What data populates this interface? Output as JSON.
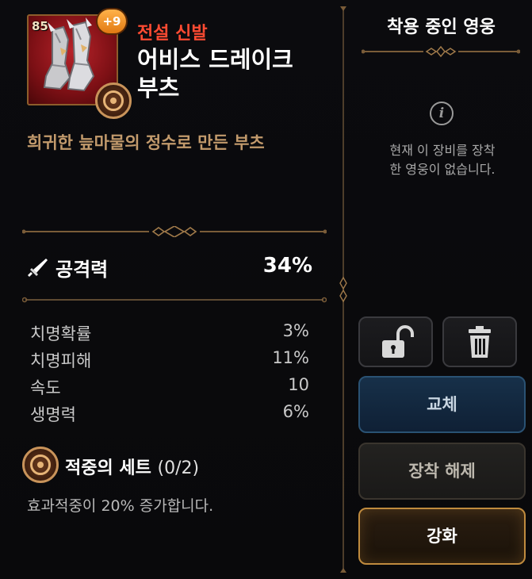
{
  "item": {
    "level": "85",
    "enhance": "+9",
    "grade": "전설 신발",
    "name_line1": "어비스 드레이크",
    "name_line2": "부츠",
    "description": "희귀한 늪마물의 정수로 만든 부츠"
  },
  "main_stat": {
    "icon": "sword-icon",
    "label": "공격력",
    "value": "34%"
  },
  "sub_stats": [
    {
      "label": "치명확률",
      "value": "3%"
    },
    {
      "label": "치명피해",
      "value": "11%"
    },
    {
      "label": "속도",
      "value": "10"
    },
    {
      "label": "생명력",
      "value": "6%"
    }
  ],
  "set": {
    "icon": "accuracy-set-emblem-icon",
    "name": "적중의 세트",
    "count": "(0/2)",
    "effect": "효과적중이 20% 증가합니다."
  },
  "equipped_hero": {
    "title": "착용 중인 영웅",
    "info_icon": "info-icon",
    "empty_message_line1": "현재 이 장비를 장착",
    "empty_message_line2": "한 영웅이 없습니다."
  },
  "actions": {
    "lock_icon": "unlock-icon",
    "delete_icon": "trash-icon",
    "replace": "교체",
    "unequip": "장착 해제",
    "enhance": "강화"
  },
  "colors": {
    "grade_legendary": "#ff4b32",
    "description": "#c29a6c",
    "frame_gold": "#8d5d2b",
    "enhance_badge": "#f39a2a"
  }
}
